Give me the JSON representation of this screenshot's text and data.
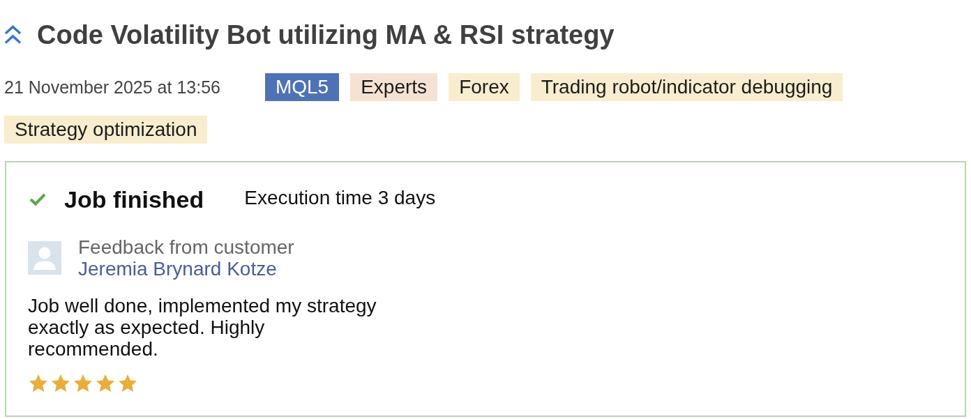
{
  "title": {
    "text": "Code Volatility Bot utilizing MA & RSI strategy"
  },
  "meta": {
    "date": "21 November 2025 at 13:56",
    "tags": [
      {
        "label": "MQL5",
        "color": "#4f72b6"
      },
      {
        "label": "Experts",
        "color": "#f6e2d3"
      },
      {
        "label": "Forex",
        "color": "#f8edcf"
      },
      {
        "label": "Trading robot/indicator debugging",
        "color": "#f8edcf"
      },
      {
        "label": "Strategy optimization",
        "color": "#f8edcf"
      }
    ]
  },
  "status": {
    "kind": "finished",
    "label": "Job finished",
    "execution_time": "Execution time 3 days"
  },
  "feedback": {
    "heading": "Feedback from customer",
    "customer": "Jeremia Brynard Kotze",
    "comment": "Job well done, implemented my strategy exactly as expected. Highly recommended.",
    "stars": 5
  }
}
